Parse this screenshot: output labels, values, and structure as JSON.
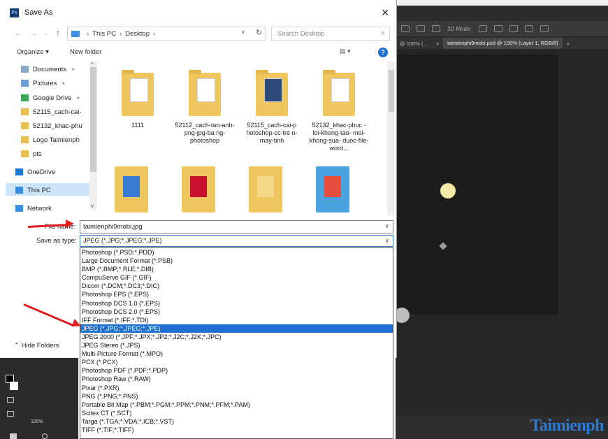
{
  "dialog": {
    "title": "Save As",
    "app_icon_text": "Ps",
    "close_glyph": "✕",
    "breadcrumb": [
      "This PC",
      "Desktop"
    ],
    "search_placeholder": "Search Desktop",
    "organize_label": "Organize ▾",
    "new_folder_label": "New folder",
    "nav_items": [
      {
        "label": "Documents",
        "icon": "document-icon",
        "pinned": true
      },
      {
        "label": "Pictures",
        "icon": "pictures-icon",
        "pinned": true
      },
      {
        "label": "Google Drive",
        "icon": "google-drive-icon",
        "pinned": true
      },
      {
        "label": "52115_cach-cai-",
        "icon": "folder-icon",
        "pinned": false
      },
      {
        "label": "52132_khac-phu",
        "icon": "folder-icon",
        "pinned": false
      },
      {
        "label": "Logo Taimienph",
        "icon": "image-icon",
        "pinned": false
      },
      {
        "label": "pts",
        "icon": "folder-icon",
        "pinned": false
      },
      {
        "label": "OneDrive",
        "icon": "onedrive-icon",
        "pinned": false
      },
      {
        "label": "This PC",
        "icon": "this-pc-icon",
        "pinned": false,
        "selected": true
      },
      {
        "label": "Network",
        "icon": "network-icon",
        "pinned": false
      }
    ],
    "files": [
      {
        "label": "1111"
      },
      {
        "label": "52112_cach-tao-anh-png-jpg-ba ng-photoshop"
      },
      {
        "label": "52115_cach-cai-p hotoshop-cc-tre n-may-tinh"
      },
      {
        "label": "52132_khac-phuc -loi-khong-tao- moi-khong-sua- duoc-file-word..."
      }
    ],
    "file_name_label": "File name:",
    "file_name_value": "taimienphi9mobi.jpg",
    "save_as_type_label": "Save as type:",
    "save_as_type_value": "JPEG (*.JPG;*.JPEG;*.JPE)",
    "hide_folders_label": "Hide Folders",
    "type_options": [
      "Photoshop (*.PSD;*.PDD)",
      "Large Document Format (*.PSB)",
      "BMP (*.BMP;*.RLE;*.DIB)",
      "CompuServe GIF (*.GIF)",
      "Dicom (*.DCM;*.DC3;*.DIC)",
      "Photoshop EPS (*.EPS)",
      "Photoshop DCS 1.0 (*.EPS)",
      "Photoshop DCS 2.0 (*.EPS)",
      "IFF Format (*.IFF;*.TDI)",
      "JPEG (*.JPG;*.JPEG;*.JPE)",
      "JPEG 2000 (*.JPF;*.JPX;*.JP2;*.J2C;*.J2K;*.JPC)",
      "JPEG Stereo (*.JPS)",
      "Multi-Picture Format (*.MPO)",
      "PCX (*.PCX)",
      "Photoshop PDF (*.PDF;*.PDP)",
      "Photoshop Raw (*.RAW)",
      "Pixar (*.PXR)",
      "PNG (*.PNG;*.PNS)",
      "Portable Bit Map (*.PBM;*.PGM;*.PPM;*.PNM;*.PFM;*.PAM)",
      "Scitex CT (*.SCT)",
      "Targa (*.TGA;*.VDA;*.ICB;*.VST)",
      "TIFF (*.TIF;*.TIFF)"
    ],
    "selected_type_index": 9
  },
  "photoshop": {
    "tab_inactive": "@ 100% (...",
    "tab_active": "taimienphi9mobi.psd @ 100% (Layer 1, RGB/8)",
    "toolbar_label": "3D Mode:",
    "zoom_label": "100%",
    "watermark": "Taimienph"
  },
  "colors": {
    "selection": "#1e6fd0",
    "arrow": "#e02020",
    "ps_background": "#2b2b2b"
  }
}
